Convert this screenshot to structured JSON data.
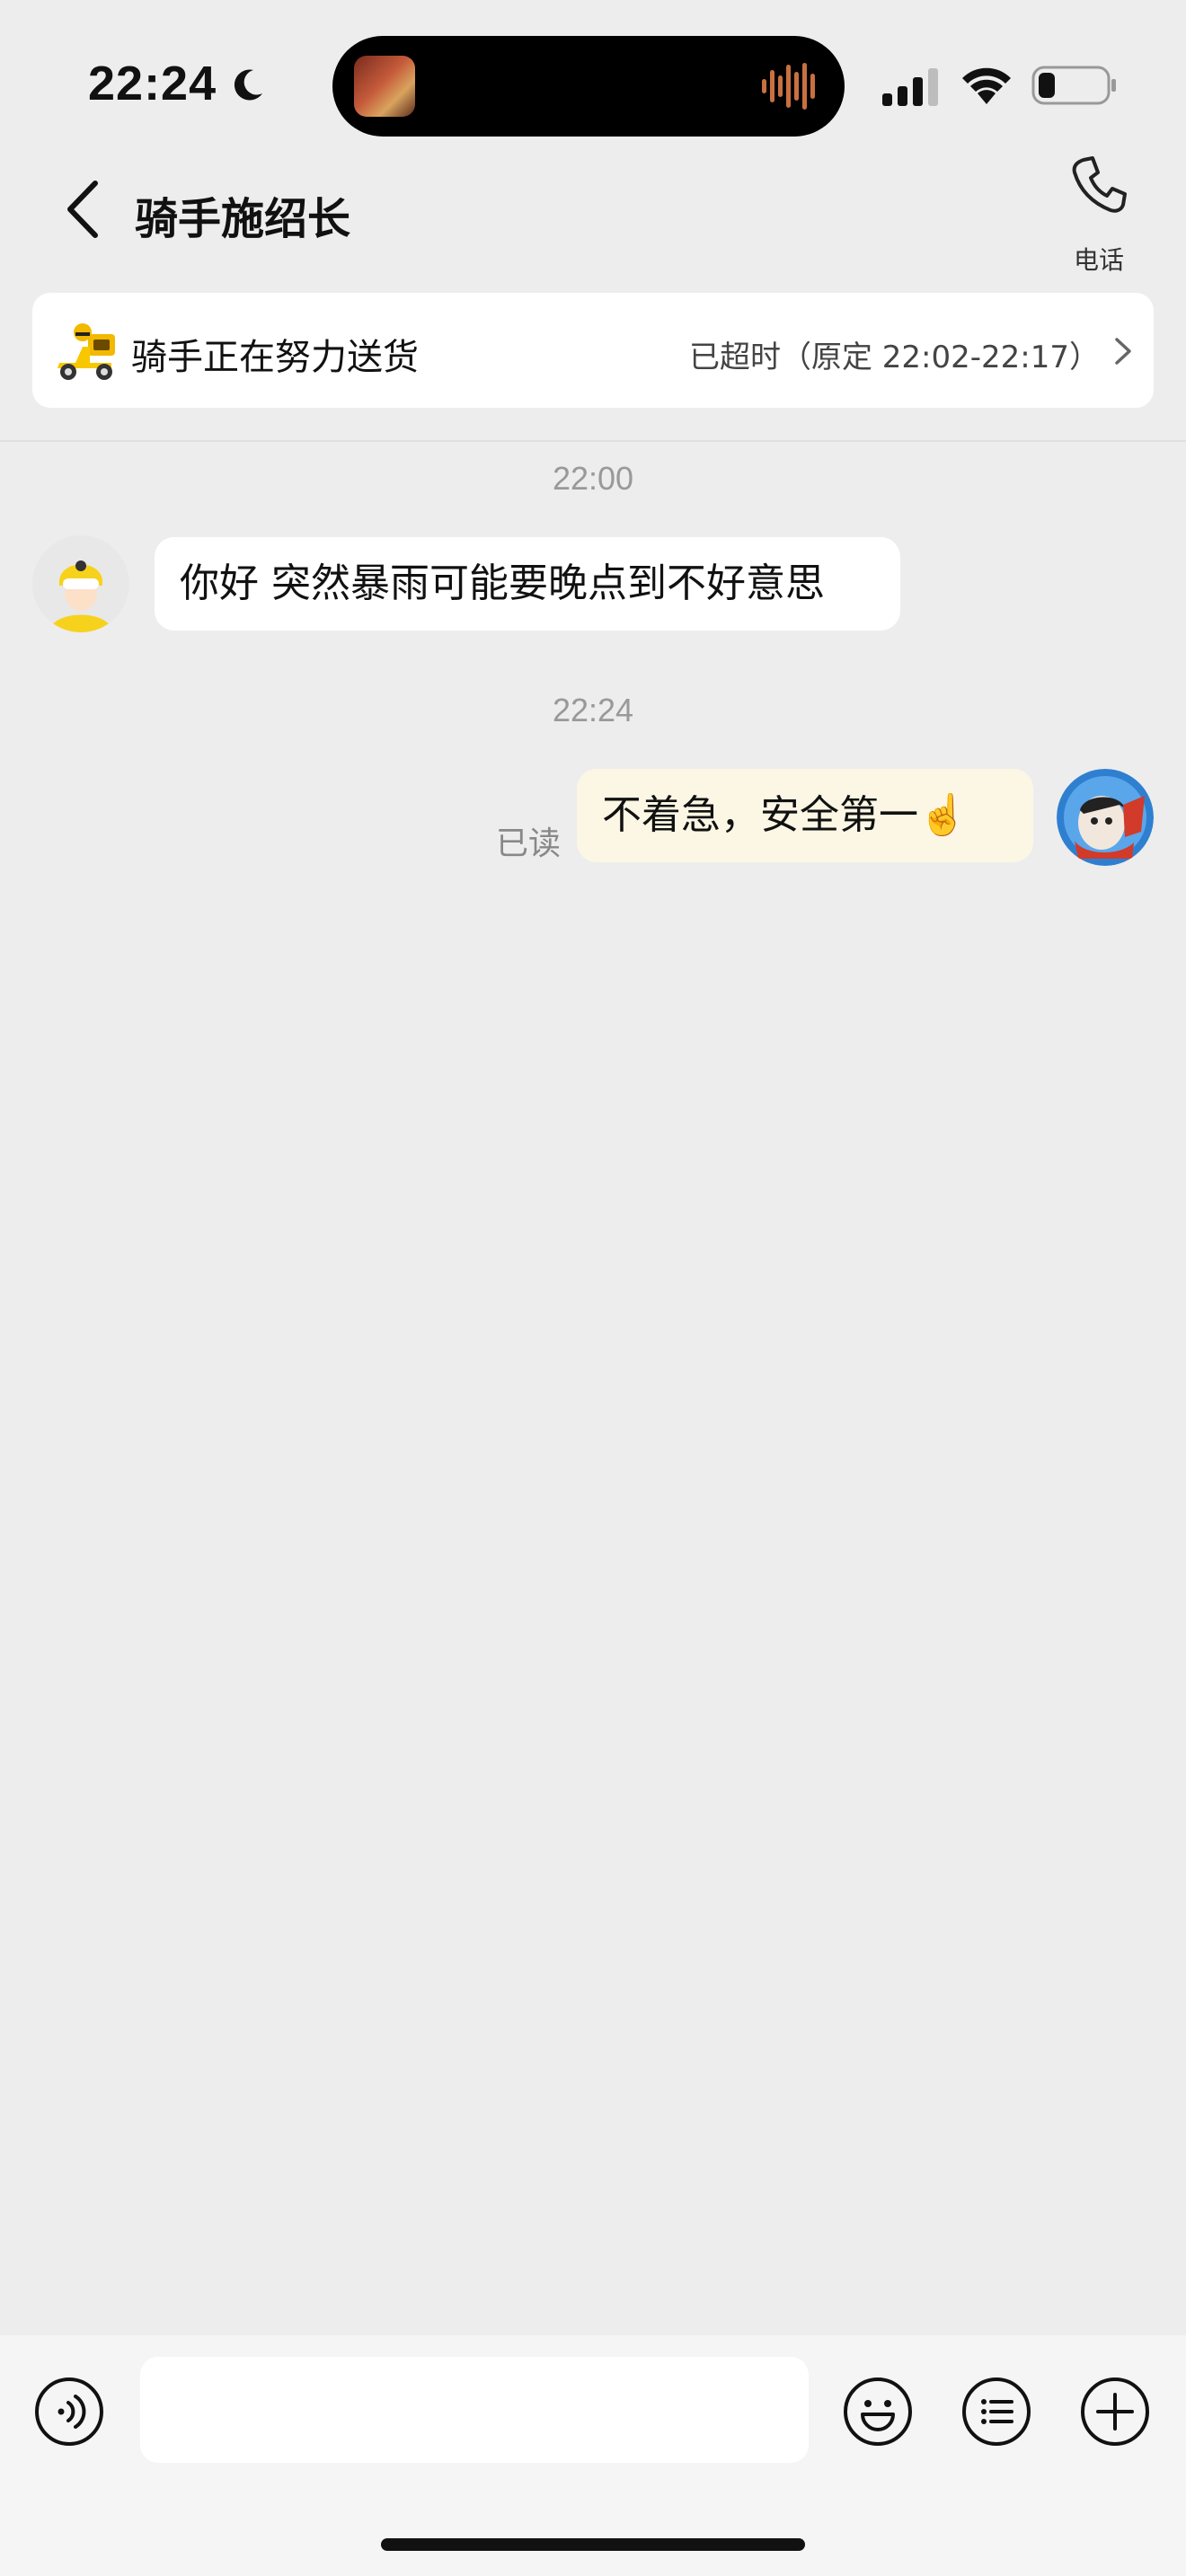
{
  "status_bar": {
    "time": "22:24"
  },
  "header": {
    "title": "骑手施绍长",
    "call_label": "电话"
  },
  "delivery": {
    "status": "骑手正在努力送货",
    "time_note": "已超时（原定 22:02-22:17）"
  },
  "messages": [
    {
      "timestamp": "22:00",
      "sender": "rider",
      "text": "你好 突然暴雨可能要晚点到不好意思"
    },
    {
      "timestamp": "22:24",
      "sender": "me",
      "text": "不着急，安全第一☝️",
      "read_label": "已读"
    }
  ],
  "input": {
    "value": "",
    "placeholder": ""
  },
  "colors": {
    "background": "#ededed",
    "rider_yellow": "#f7d21c",
    "my_bubble": "#fbf7e4"
  }
}
